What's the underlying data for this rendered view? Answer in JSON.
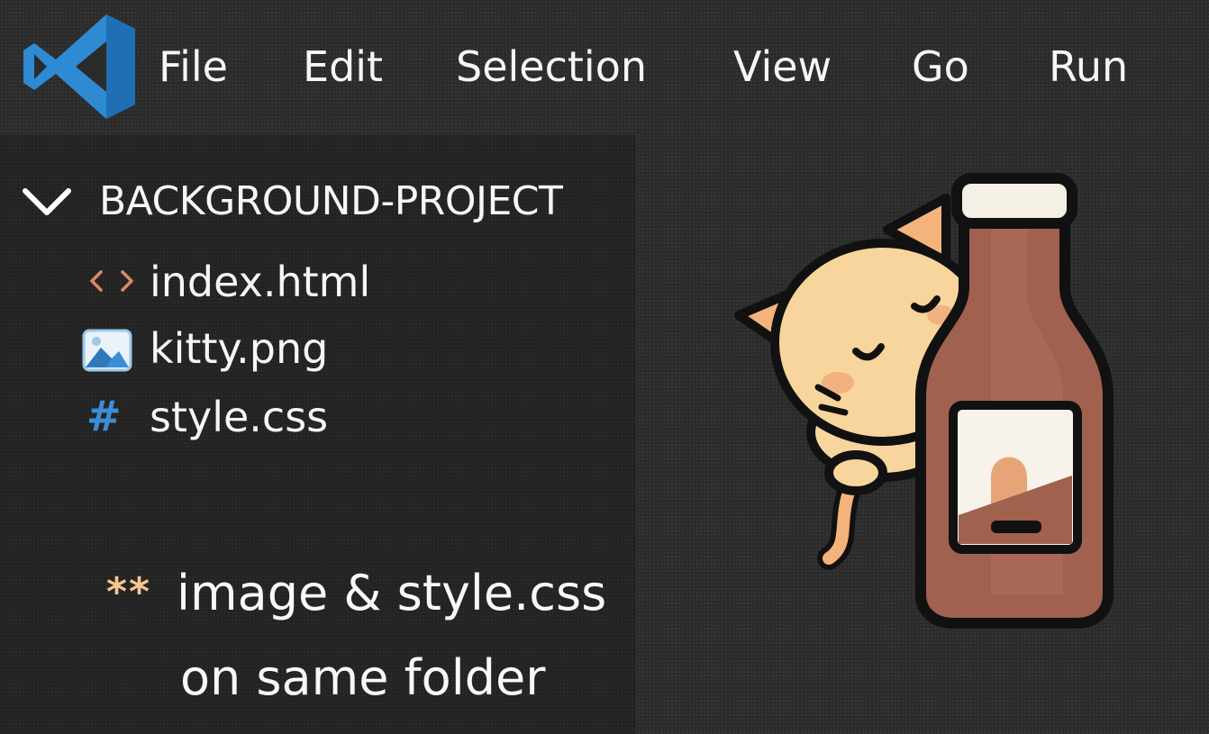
{
  "menu": {
    "items": [
      "File",
      "Edit",
      "Selection",
      "View",
      "Go",
      "Run"
    ]
  },
  "explorer": {
    "folder": "BACKGROUND-PROJECT",
    "files": [
      {
        "name": "index.html",
        "icon": "html-icon"
      },
      {
        "name": "kitty.png",
        "icon": "image-icon"
      },
      {
        "name": "style.css",
        "icon": "hash-icon",
        "glyph": "#"
      }
    ]
  },
  "note": {
    "stars": "**",
    "line1": "image & style.css",
    "line2": "on same folder"
  },
  "colors": {
    "background": "#2b2b2b",
    "sidebar": "#232323",
    "vscode_blue": "#2f8ad4",
    "html_icon": "#e0876a",
    "css_icon": "#3b8ed6",
    "stars": "#f9c58c"
  }
}
